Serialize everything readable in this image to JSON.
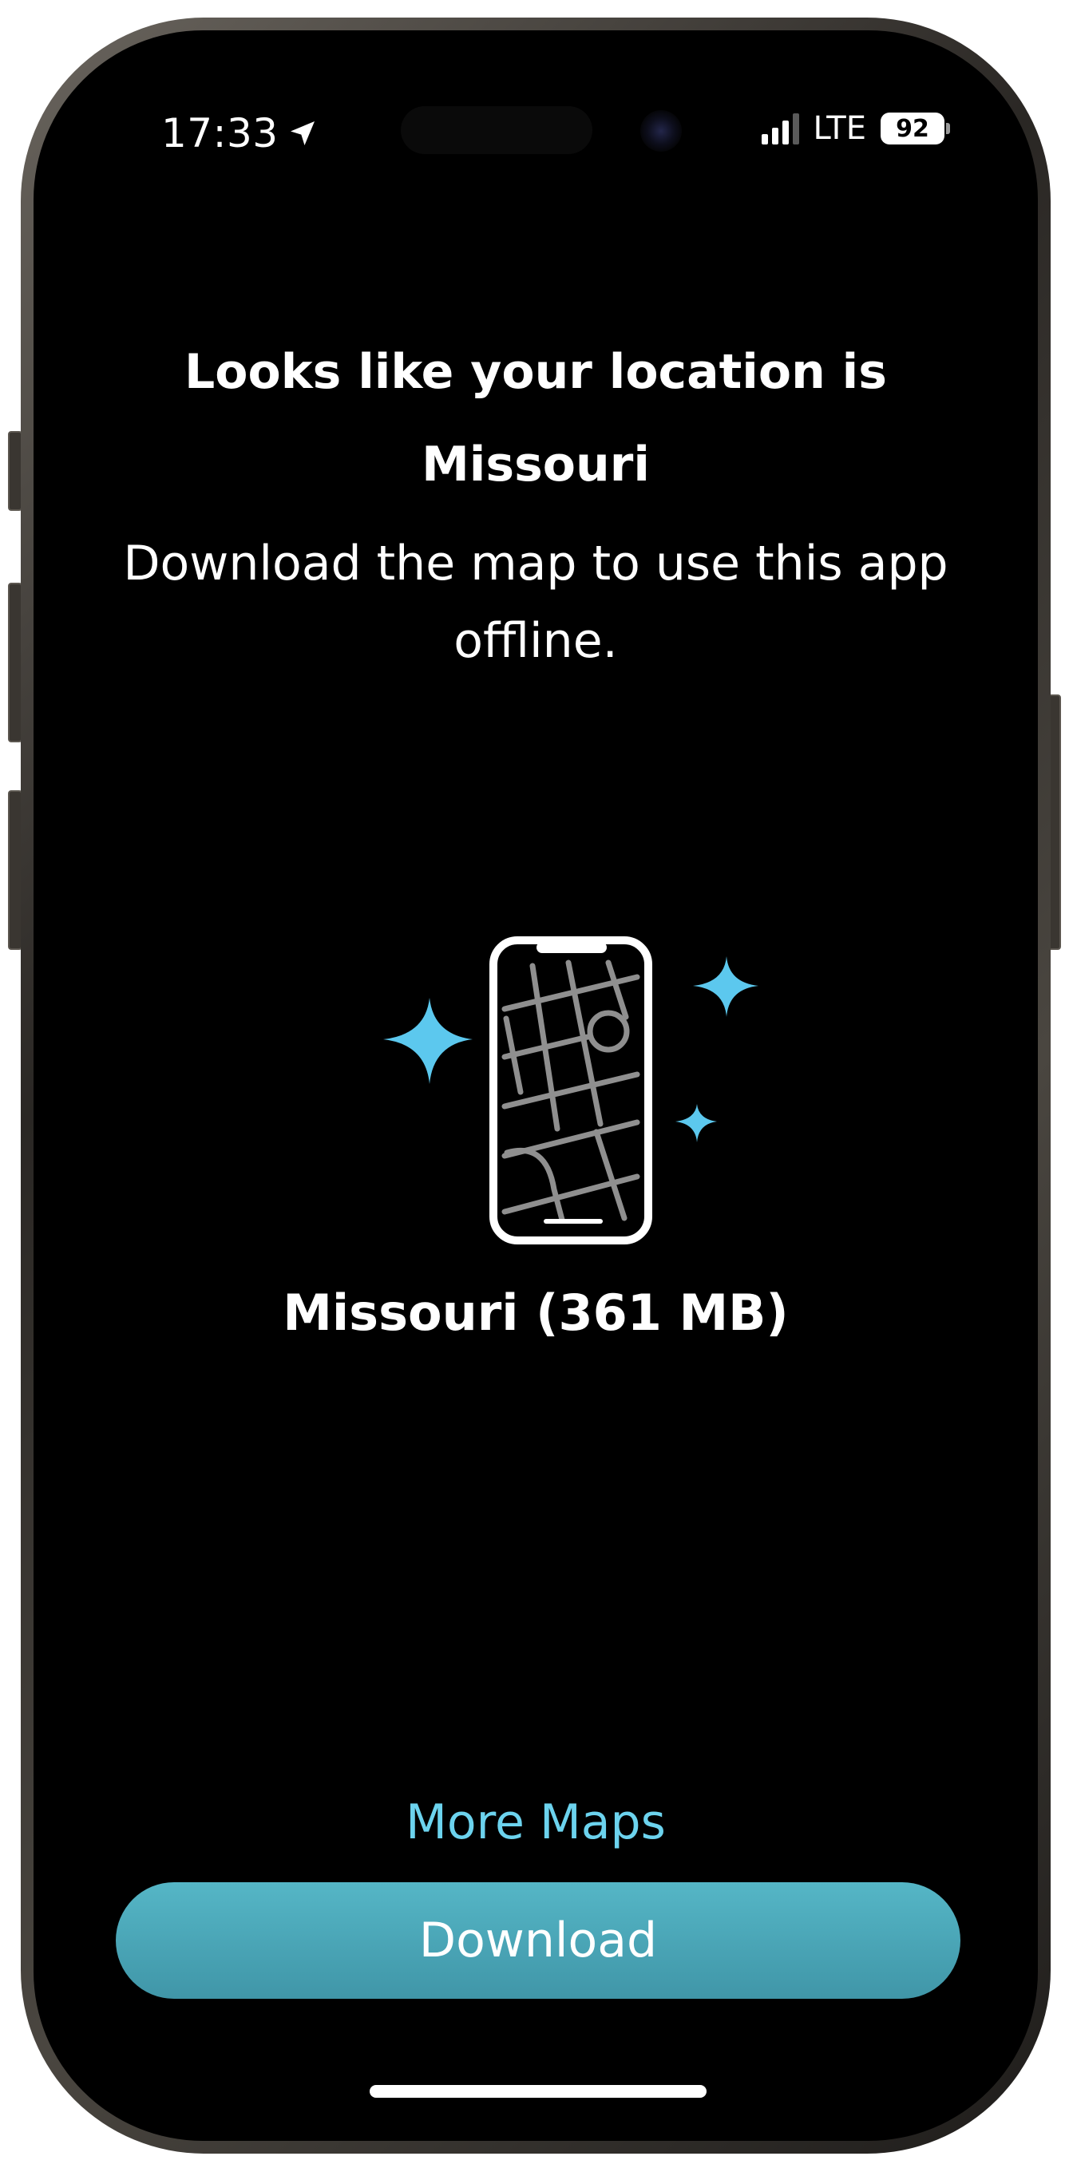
{
  "status_bar": {
    "time": "17:33",
    "location_icon": "location-arrow-icon",
    "network": "LTE",
    "battery_level": "92",
    "signal_bars": 3,
    "signal_total": 4
  },
  "prompt": {
    "heading_line1": "Looks like your location is",
    "heading_line2": "Missouri",
    "subtext_line1": "Download the map to use this app",
    "subtext_line2": "offline."
  },
  "illustration": {
    "icon": "phone-map-icon",
    "sparkle_icon": "sparkle-icon"
  },
  "map": {
    "name_size": "Missouri (361 MB)"
  },
  "actions": {
    "more_maps": "More Maps",
    "download": "Download"
  },
  "colors": {
    "background": "#000000",
    "accent": "#6cd3ee",
    "button": "#4aa8ba",
    "text": "#ffffff"
  }
}
